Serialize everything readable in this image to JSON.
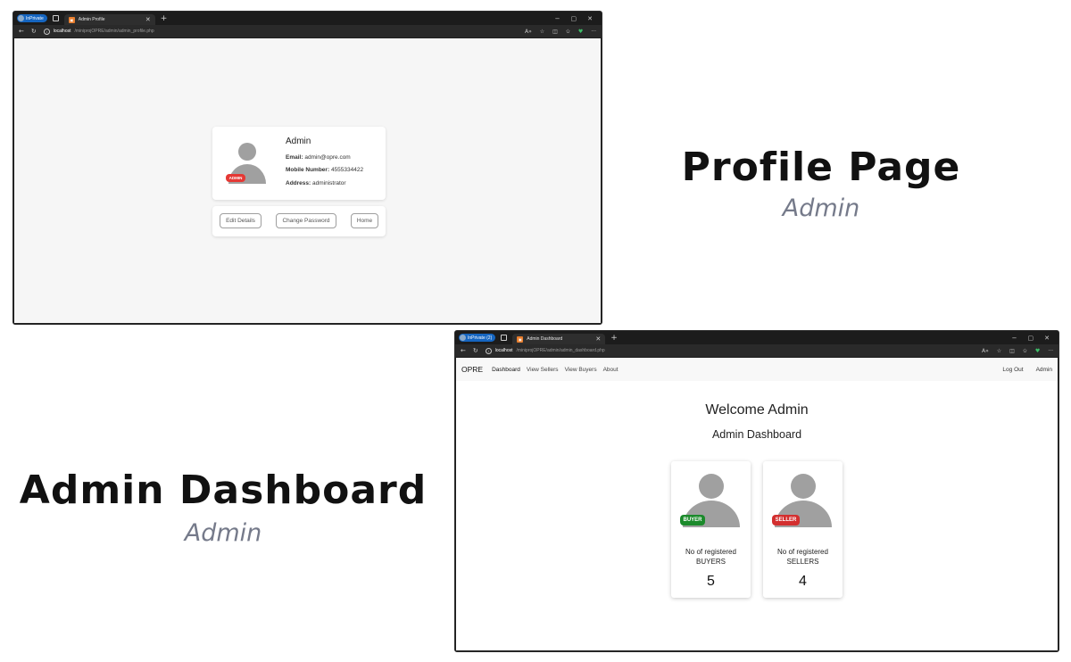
{
  "profile_window": {
    "inprivate_label": "InPrivate",
    "tab_title": "Admin Profile",
    "url_host": "localhost",
    "url_path": "/miniprojOPRE/admin/admin_profile.php",
    "profile": {
      "name": "Admin",
      "role_badge": "ADMIN",
      "email_label": "Email:",
      "email": "admin@opre.com",
      "mobile_label": "Mobile Number:",
      "mobile": "4555334422",
      "address_label": "Address:",
      "address": "administrator"
    },
    "buttons": {
      "edit": "Edit Details",
      "change_password": "Change Password",
      "home": "Home"
    }
  },
  "dashboard_window": {
    "inprivate_label": "InPrivate (2)",
    "tab_title": "Admin Dashboard",
    "url_host": "localhost",
    "url_path": "/miniprojOPRE/admin/admin_dashboard.php",
    "nav": {
      "brand": "OPRE",
      "links": [
        "Dashboard",
        "View Sellers",
        "View Buyers",
        "About"
      ],
      "right": [
        "Log Out",
        "Admin"
      ]
    },
    "welcome": "Welcome Admin",
    "subtitle": "Admin Dashboard",
    "cards": [
      {
        "badge": "BUYER",
        "label_line1": "No of registered",
        "label_line2": "BUYERS",
        "count": "5",
        "badge_color": "#1b8a2b"
      },
      {
        "badge": "SELLER",
        "label_line1": "No of registered",
        "label_line2": "SELLERS",
        "count": "4",
        "badge_color": "#d32f2f"
      }
    ]
  },
  "captions": {
    "profile_title": "Profile Page",
    "profile_sub": "Admin",
    "dashboard_title": "Admin Dashboard",
    "dashboard_sub": "Admin"
  },
  "colors": {
    "inprivate": "#1565c0",
    "admin_badge": "#e53935",
    "caption_sub": "#757a8a"
  }
}
